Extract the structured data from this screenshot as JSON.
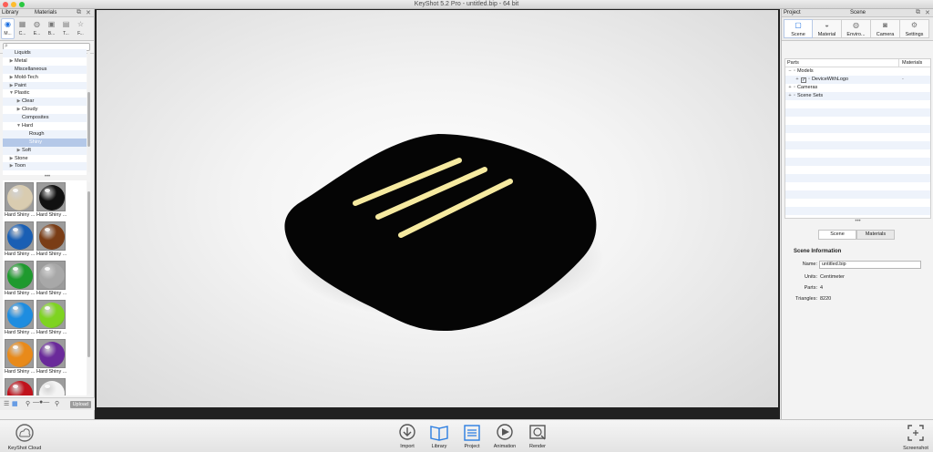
{
  "window": {
    "title": "KeyShot 5.2 Pro  - untitled.bip  - 64 bit"
  },
  "library": {
    "header_left": "Library",
    "header_right": "Materials",
    "tabs": [
      {
        "label": "M...",
        "icon": "materials-icon"
      },
      {
        "label": "C...",
        "icon": "colors-icon"
      },
      {
        "label": "E...",
        "icon": "environments-icon"
      },
      {
        "label": "B...",
        "icon": "backplates-icon"
      },
      {
        "label": "T...",
        "icon": "textures-icon"
      },
      {
        "label": "F...",
        "icon": "favorites-icon"
      }
    ],
    "tree": [
      {
        "label": "Liquids",
        "indent": 1,
        "arrow": ""
      },
      {
        "label": "Metal",
        "indent": 1,
        "arrow": "▶"
      },
      {
        "label": "Miscellaneous",
        "indent": 1,
        "arrow": ""
      },
      {
        "label": "Mold-Tech",
        "indent": 1,
        "arrow": "▶"
      },
      {
        "label": "Paint",
        "indent": 1,
        "arrow": "▶"
      },
      {
        "label": "Plastic",
        "indent": 1,
        "arrow": "▼"
      },
      {
        "label": "Clear",
        "indent": 2,
        "arrow": "▶"
      },
      {
        "label": "Cloudy",
        "indent": 2,
        "arrow": "▶"
      },
      {
        "label": "Composites",
        "indent": 2,
        "arrow": ""
      },
      {
        "label": "Hard",
        "indent": 2,
        "arrow": "▼"
      },
      {
        "label": "Rough",
        "indent": 3,
        "arrow": ""
      },
      {
        "label": "Shiny",
        "indent": 3,
        "arrow": "",
        "selected": true
      },
      {
        "label": "Soft",
        "indent": 2,
        "arrow": "▶"
      },
      {
        "label": "Stone",
        "indent": 1,
        "arrow": "▶"
      },
      {
        "label": "Toon",
        "indent": 1,
        "arrow": "▶"
      }
    ],
    "materials": [
      {
        "caption": "Hard Shiny ...",
        "color": "#d9ccb0"
      },
      {
        "caption": "Hard Shiny ...",
        "color": "#111111"
      },
      {
        "caption": "Hard Shiny ...",
        "color": "#1a5fb4"
      },
      {
        "caption": "Hard Shiny ...",
        "color": "#7a3d16"
      },
      {
        "caption": "Hard Shiny ...",
        "color": "#1f9a2e"
      },
      {
        "caption": "Hard Shiny ...",
        "color": "#a8a8a8"
      },
      {
        "caption": "Hard Shiny ...",
        "color": "#1e8de0"
      },
      {
        "caption": "Hard Shiny ...",
        "color": "#7ed321"
      },
      {
        "caption": "Hard Shiny ...",
        "color": "#e88a1a"
      },
      {
        "caption": "Hard Shiny ...",
        "color": "#6a2a9a"
      },
      {
        "caption": "Hard Shiny ...",
        "color": "#c0121c"
      },
      {
        "caption": "Hard Shiny ...",
        "color": "#f4f4f4"
      }
    ],
    "upload_label": "Upload"
  },
  "project": {
    "header_left": "Project",
    "header_right": "Scene",
    "tabs": [
      {
        "label": "Scene",
        "icon": "scene-icon"
      },
      {
        "label": "Material",
        "icon": "material-icon"
      },
      {
        "label": "Enviro...",
        "icon": "environment-icon"
      },
      {
        "label": "Camera",
        "icon": "camera-icon"
      },
      {
        "label": "Settings",
        "icon": "settings-icon"
      }
    ],
    "parts_header": "Parts",
    "materials_header": "Materials",
    "parts_rows": [
      {
        "label": "Models",
        "indent": 0,
        "toggle": "−",
        "checkbox": false,
        "dash": ""
      },
      {
        "label": "DeviceWithLogo",
        "indent": 1,
        "toggle": "+",
        "checkbox": true,
        "dash": "-"
      },
      {
        "label": "Cameras",
        "indent": 0,
        "toggle": "+",
        "checkbox": false,
        "dash": ""
      },
      {
        "label": "Scene Sets",
        "indent": 0,
        "toggle": "+",
        "checkbox": false,
        "dash": ""
      }
    ],
    "info_tabs": [
      "Scene",
      "Materials"
    ],
    "info_title": "Scene Information",
    "info": {
      "name_label": "Name:",
      "name_value": "untitled.bip",
      "units_label": "Units:",
      "units_value": "Centimeter",
      "parts_label": "Parts:",
      "parts_value": "4",
      "triangles_label": "Triangles:",
      "triangles_value": "8220"
    }
  },
  "toolbar": {
    "cloud": "KeyShot Cloud",
    "import": "Import",
    "library": "Library",
    "project": "Project",
    "animation": "Animation",
    "render": "Render",
    "screenshot": "Screenshot"
  },
  "colors": {
    "accent": "#1c6fe0",
    "device_body": "#050505",
    "logo_stripes": "#f6eaa0"
  }
}
